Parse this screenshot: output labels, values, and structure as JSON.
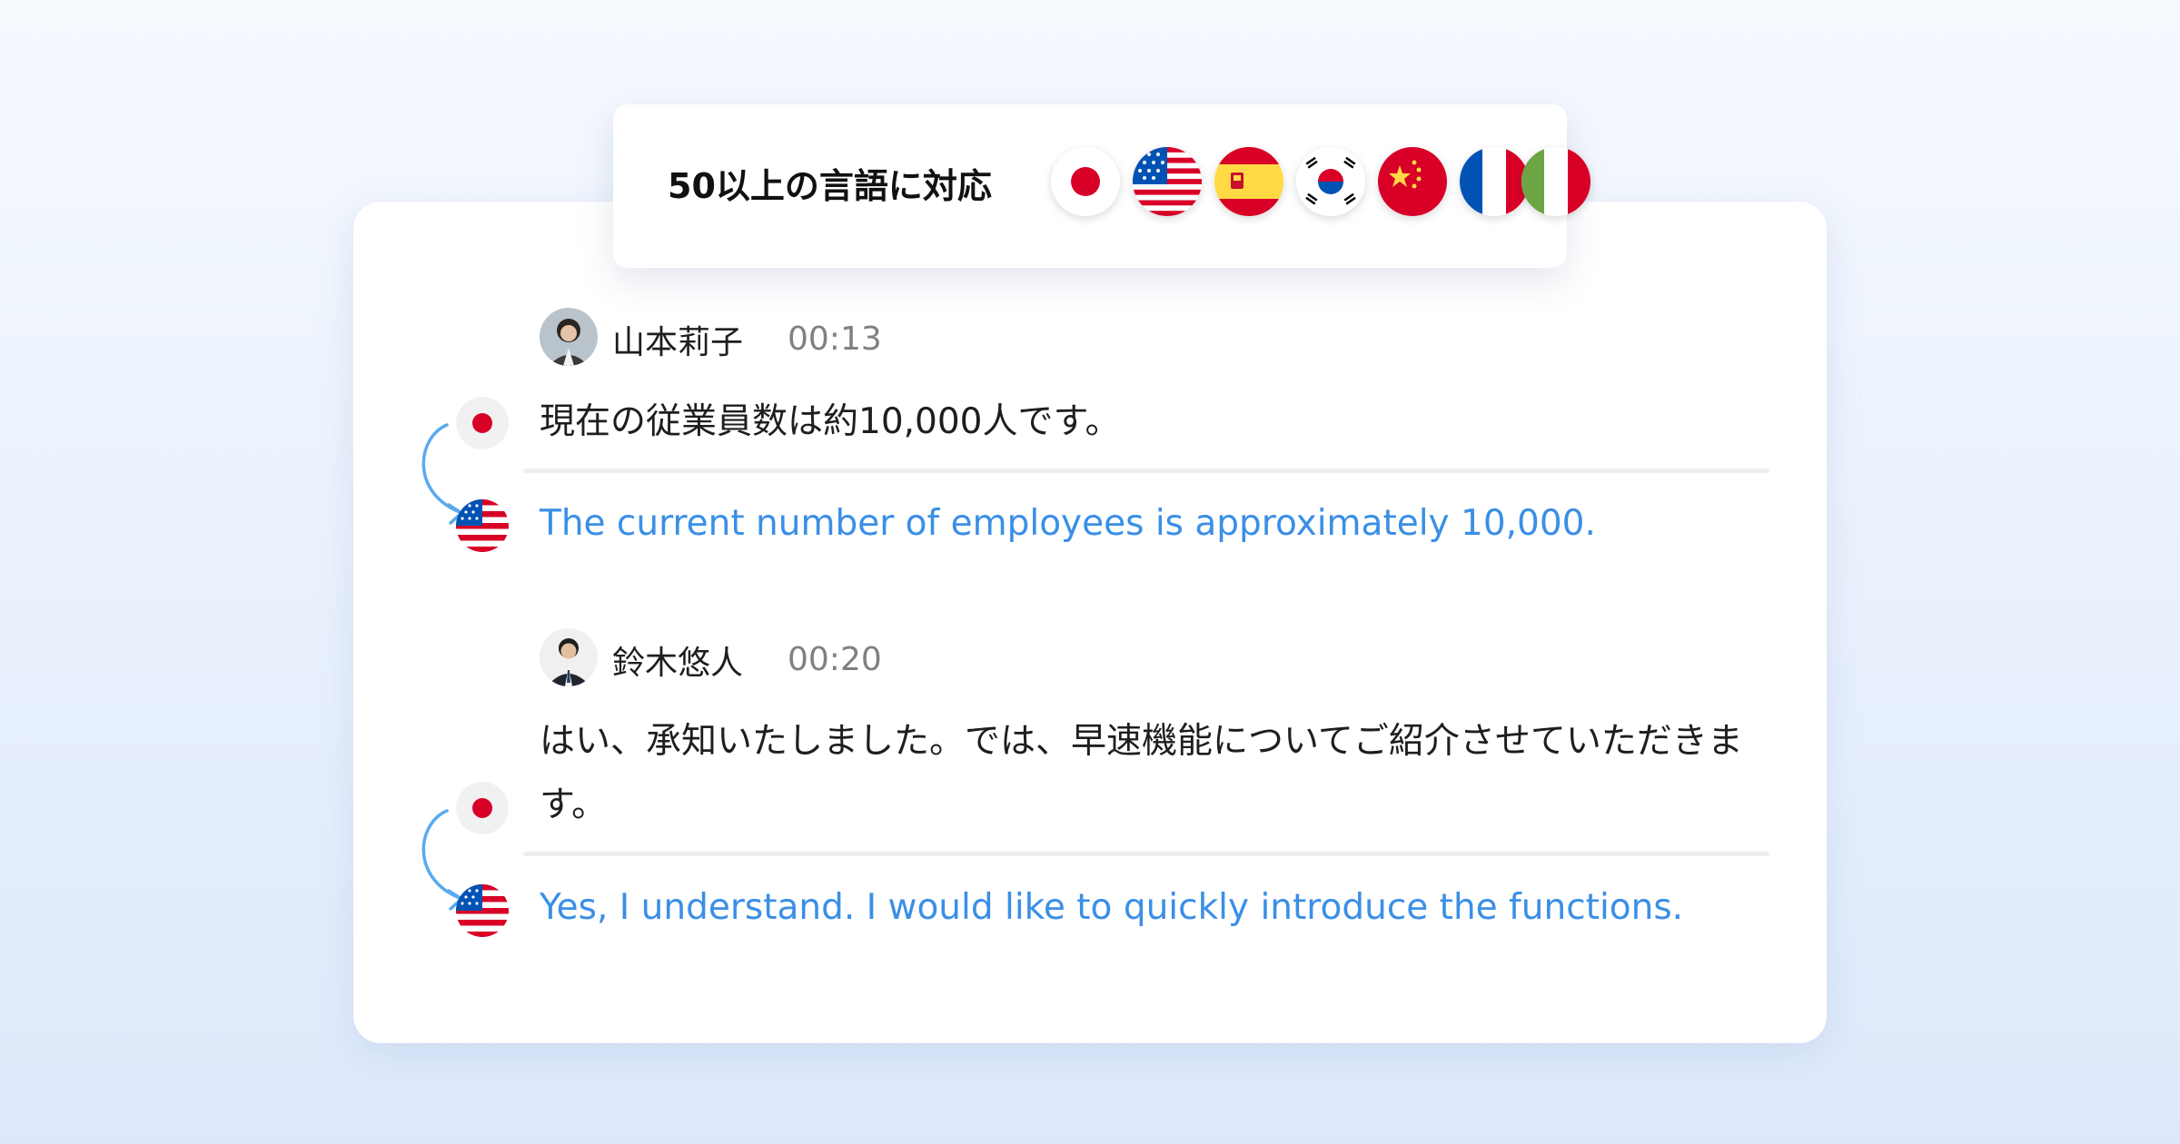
{
  "banner": {
    "title": "50以上の言語に対応",
    "flags": [
      "japan-flag",
      "usa-flag",
      "spain-flag",
      "korea-flag",
      "china-flag",
      "france-flag",
      "italy-flag"
    ]
  },
  "messages": [
    {
      "speaker": "山本莉子",
      "time": "00:13",
      "original": "現在の従業員数は約10,000人です。",
      "translation": "The current number of employees is approximately 10,000."
    },
    {
      "speaker": "鈴木悠人",
      "time": "00:20",
      "original": "はい、承知いたしました。では、早速機能についてご紹介させていただきます。",
      "translation": "Yes, I understand. I would like to quickly introduce the functions."
    }
  ],
  "colors": {
    "translation_text": "#3a8fe6",
    "arrow": "#5aaaf0",
    "divider": "#eeeeee"
  }
}
